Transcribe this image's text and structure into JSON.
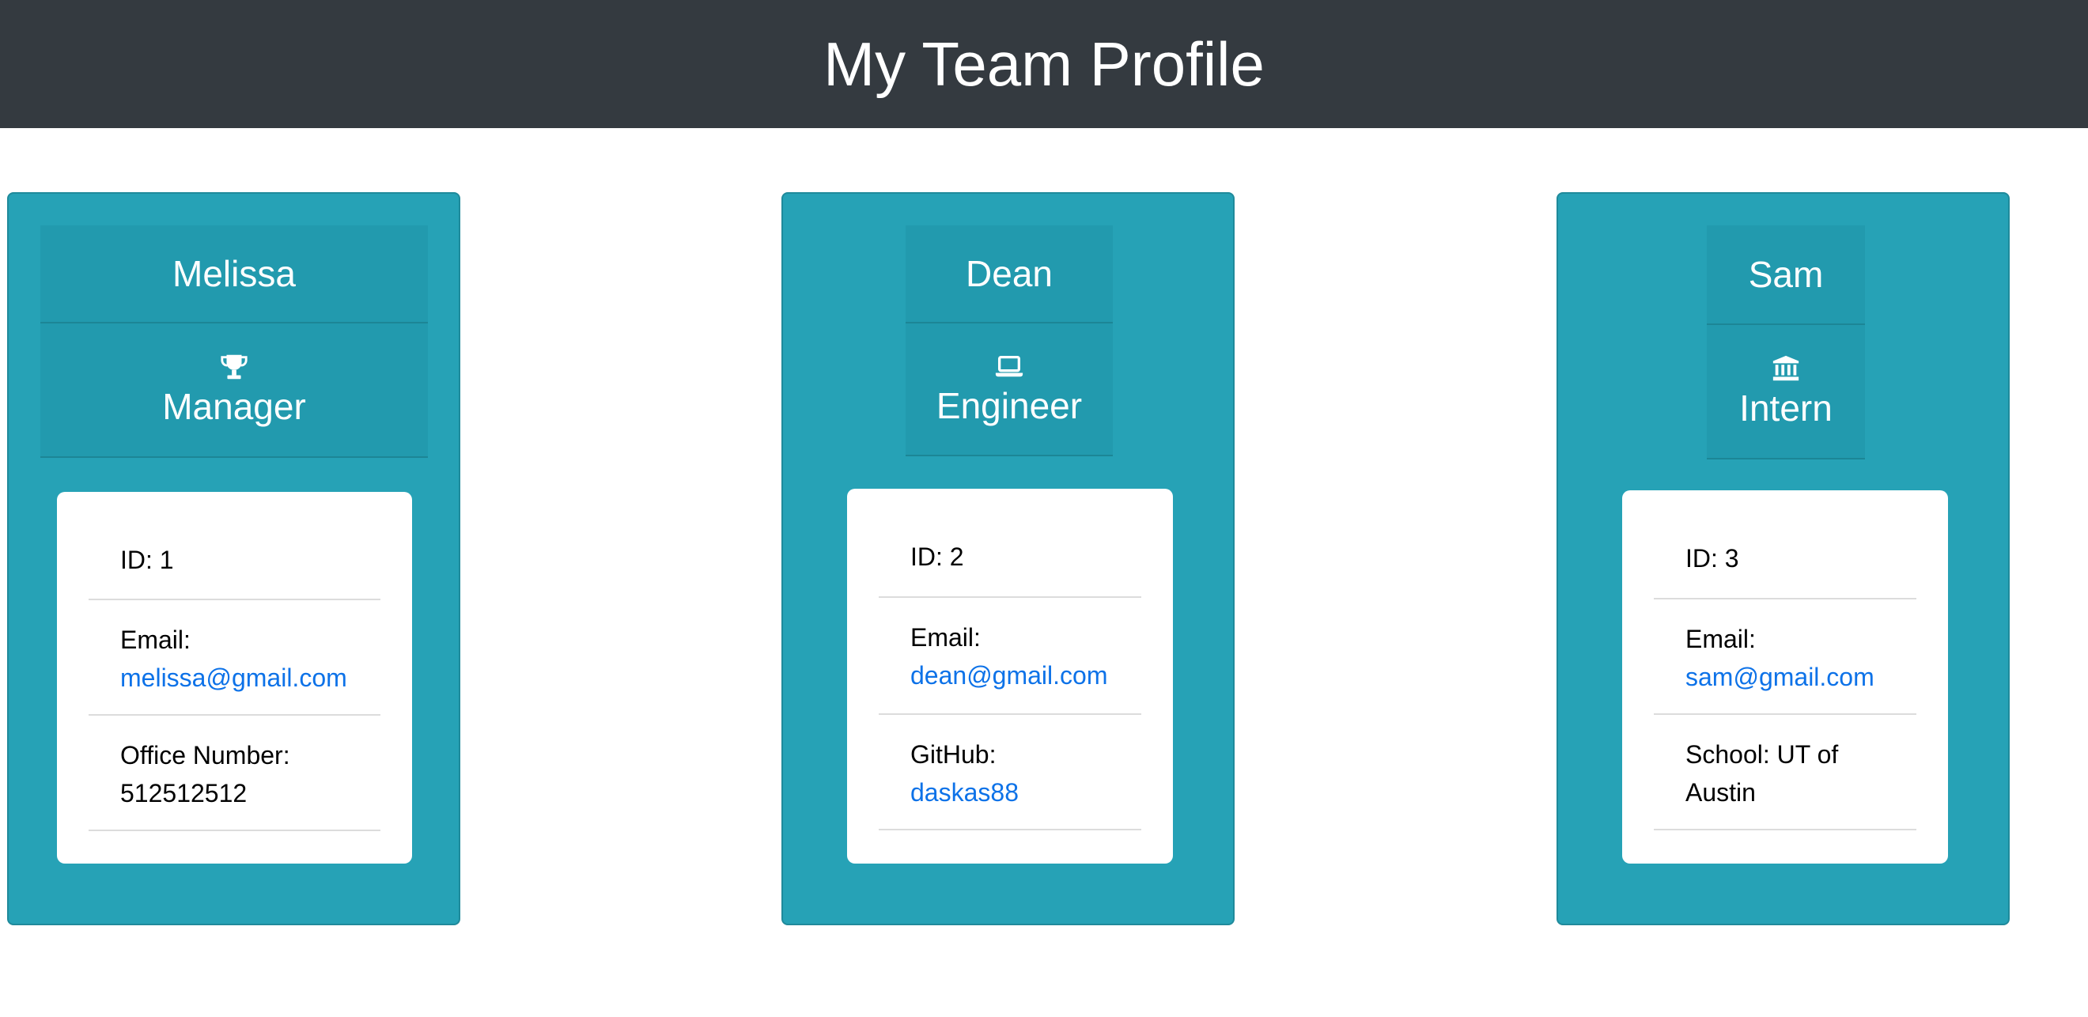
{
  "header": {
    "title": "My Team Profile"
  },
  "colors": {
    "header_bg": "#343a40",
    "card_bg": "#26a2b6",
    "card_head_bg": "#229aae",
    "link": "#0d72e8"
  },
  "cards": [
    {
      "name": "Melissa",
      "role": "Manager",
      "role_icon": "trophy-icon",
      "id_label": "ID: 1",
      "email_label": "Email:",
      "email": "melissa@gmail.com",
      "extra_label": "Office Number:",
      "extra_value": "512512512"
    },
    {
      "name": "Dean",
      "role": "Engineer",
      "role_icon": "laptop-icon",
      "id_label": "ID: 2",
      "email_label": "Email:",
      "email": "dean@gmail.com",
      "extra_label": "GitHub:",
      "extra_value": "daskas88"
    },
    {
      "name": "Sam",
      "role": "Intern",
      "role_icon": "university-icon",
      "id_label": "ID: 3",
      "email_label": "Email:",
      "email": "sam@gmail.com",
      "extra_label": "School: UT of",
      "extra_value": "Austin"
    }
  ]
}
